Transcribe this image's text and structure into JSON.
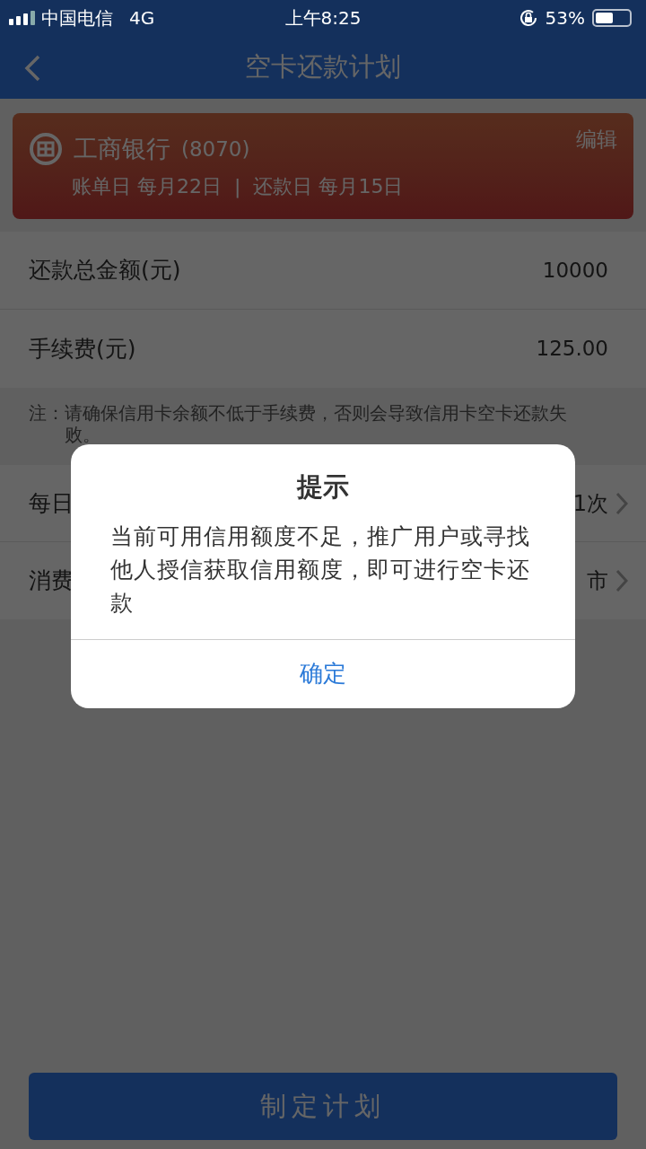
{
  "status_bar": {
    "carrier": "中国电信",
    "network": "4G",
    "time": "上午8:25",
    "battery": "53%"
  },
  "nav": {
    "title": "空卡还款计划"
  },
  "card": {
    "bank": "工商银行",
    "number": "(8070)",
    "edit": "编辑",
    "bill_day": "账单日 每月22日",
    "separator": "|",
    "repay_day": "还款日 每月15日"
  },
  "rows": [
    {
      "label": "还款总金额(元)",
      "value": "10000",
      "kind": "value"
    },
    {
      "label": "手续费(元)",
      "value": "125.00",
      "kind": "value"
    }
  ],
  "note": {
    "prefix": "注：",
    "text": "请确保信用卡余额不低于手续费，否则会导致信用卡空卡还款失败。"
  },
  "options": [
    {
      "label": "每日",
      "value": "1次"
    },
    {
      "label": "消费",
      "value": "市"
    }
  ],
  "submit": "制定计划",
  "dialog": {
    "title": "提示",
    "message": "当前可用信用额度不足，推广用户或寻找他人授信获取信用额度，即可进行空卡还款",
    "button": "确定"
  }
}
